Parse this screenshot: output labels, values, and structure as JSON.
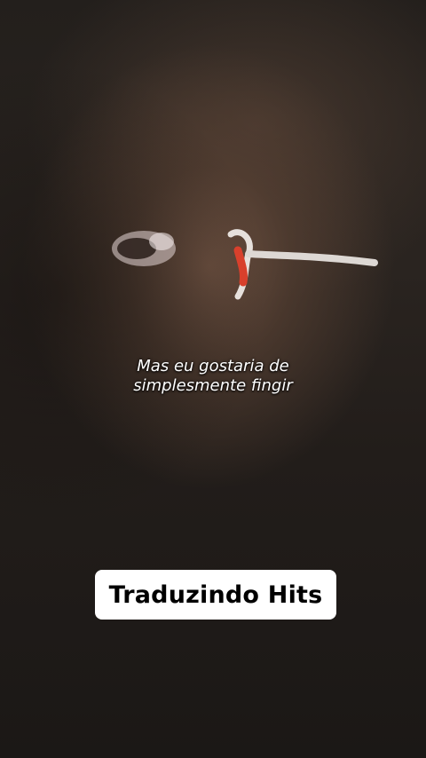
{
  "video": {
    "subtitle_lines": [
      "Mas eu gostaria de",
      "simplesmente fingir"
    ]
  },
  "badge": {
    "label": "Traduzindo Hits"
  }
}
